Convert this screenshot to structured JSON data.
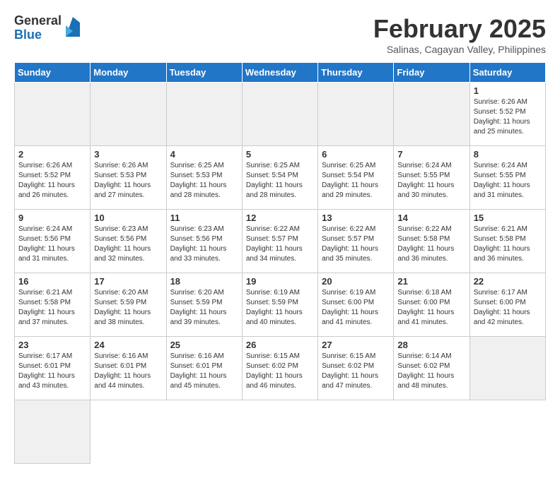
{
  "header": {
    "logo_general": "General",
    "logo_blue": "Blue",
    "month_year": "February 2025",
    "location": "Salinas, Cagayan Valley, Philippines"
  },
  "weekdays": [
    "Sunday",
    "Monday",
    "Tuesday",
    "Wednesday",
    "Thursday",
    "Friday",
    "Saturday"
  ],
  "days": [
    {
      "date": "",
      "info": ""
    },
    {
      "date": "",
      "info": ""
    },
    {
      "date": "",
      "info": ""
    },
    {
      "date": "",
      "info": ""
    },
    {
      "date": "",
      "info": ""
    },
    {
      "date": "",
      "info": ""
    },
    {
      "date": "1",
      "info": "Sunrise: 6:26 AM\nSunset: 5:52 PM\nDaylight: 11 hours\nand 25 minutes."
    },
    {
      "date": "2",
      "info": "Sunrise: 6:26 AM\nSunset: 5:52 PM\nDaylight: 11 hours\nand 26 minutes."
    },
    {
      "date": "3",
      "info": "Sunrise: 6:26 AM\nSunset: 5:53 PM\nDaylight: 11 hours\nand 27 minutes."
    },
    {
      "date": "4",
      "info": "Sunrise: 6:25 AM\nSunset: 5:53 PM\nDaylight: 11 hours\nand 28 minutes."
    },
    {
      "date": "5",
      "info": "Sunrise: 6:25 AM\nSunset: 5:54 PM\nDaylight: 11 hours\nand 28 minutes."
    },
    {
      "date": "6",
      "info": "Sunrise: 6:25 AM\nSunset: 5:54 PM\nDaylight: 11 hours\nand 29 minutes."
    },
    {
      "date": "7",
      "info": "Sunrise: 6:24 AM\nSunset: 5:55 PM\nDaylight: 11 hours\nand 30 minutes."
    },
    {
      "date": "8",
      "info": "Sunrise: 6:24 AM\nSunset: 5:55 PM\nDaylight: 11 hours\nand 31 minutes."
    },
    {
      "date": "9",
      "info": "Sunrise: 6:24 AM\nSunset: 5:56 PM\nDaylight: 11 hours\nand 31 minutes."
    },
    {
      "date": "10",
      "info": "Sunrise: 6:23 AM\nSunset: 5:56 PM\nDaylight: 11 hours\nand 32 minutes."
    },
    {
      "date": "11",
      "info": "Sunrise: 6:23 AM\nSunset: 5:56 PM\nDaylight: 11 hours\nand 33 minutes."
    },
    {
      "date": "12",
      "info": "Sunrise: 6:22 AM\nSunset: 5:57 PM\nDaylight: 11 hours\nand 34 minutes."
    },
    {
      "date": "13",
      "info": "Sunrise: 6:22 AM\nSunset: 5:57 PM\nDaylight: 11 hours\nand 35 minutes."
    },
    {
      "date": "14",
      "info": "Sunrise: 6:22 AM\nSunset: 5:58 PM\nDaylight: 11 hours\nand 36 minutes."
    },
    {
      "date": "15",
      "info": "Sunrise: 6:21 AM\nSunset: 5:58 PM\nDaylight: 11 hours\nand 36 minutes."
    },
    {
      "date": "16",
      "info": "Sunrise: 6:21 AM\nSunset: 5:58 PM\nDaylight: 11 hours\nand 37 minutes."
    },
    {
      "date": "17",
      "info": "Sunrise: 6:20 AM\nSunset: 5:59 PM\nDaylight: 11 hours\nand 38 minutes."
    },
    {
      "date": "18",
      "info": "Sunrise: 6:20 AM\nSunset: 5:59 PM\nDaylight: 11 hours\nand 39 minutes."
    },
    {
      "date": "19",
      "info": "Sunrise: 6:19 AM\nSunset: 5:59 PM\nDaylight: 11 hours\nand 40 minutes."
    },
    {
      "date": "20",
      "info": "Sunrise: 6:19 AM\nSunset: 6:00 PM\nDaylight: 11 hours\nand 41 minutes."
    },
    {
      "date": "21",
      "info": "Sunrise: 6:18 AM\nSunset: 6:00 PM\nDaylight: 11 hours\nand 41 minutes."
    },
    {
      "date": "22",
      "info": "Sunrise: 6:17 AM\nSunset: 6:00 PM\nDaylight: 11 hours\nand 42 minutes."
    },
    {
      "date": "23",
      "info": "Sunrise: 6:17 AM\nSunset: 6:01 PM\nDaylight: 11 hours\nand 43 minutes."
    },
    {
      "date": "24",
      "info": "Sunrise: 6:16 AM\nSunset: 6:01 PM\nDaylight: 11 hours\nand 44 minutes."
    },
    {
      "date": "25",
      "info": "Sunrise: 6:16 AM\nSunset: 6:01 PM\nDaylight: 11 hours\nand 45 minutes."
    },
    {
      "date": "26",
      "info": "Sunrise: 6:15 AM\nSunset: 6:02 PM\nDaylight: 11 hours\nand 46 minutes."
    },
    {
      "date": "27",
      "info": "Sunrise: 6:15 AM\nSunset: 6:02 PM\nDaylight: 11 hours\nand 47 minutes."
    },
    {
      "date": "28",
      "info": "Sunrise: 6:14 AM\nSunset: 6:02 PM\nDaylight: 11 hours\nand 48 minutes."
    },
    {
      "date": "",
      "info": ""
    },
    {
      "date": "",
      "info": ""
    }
  ]
}
